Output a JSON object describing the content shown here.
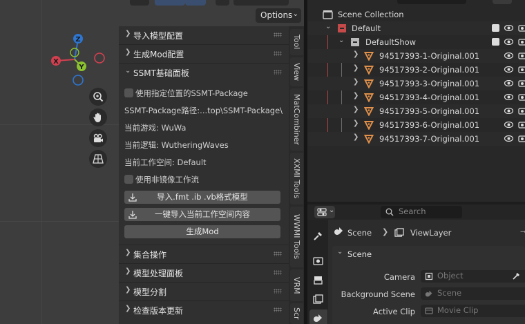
{
  "viewport": {
    "options_label": "Options",
    "gizmo": {
      "z": "Z",
      "x": "X",
      "y": "Y"
    }
  },
  "npanel": {
    "sections": [
      {
        "label": "导入模型配置",
        "expanded": false
      },
      {
        "label": "生成Mod配置",
        "expanded": false
      },
      {
        "label": "SSMT基础面板",
        "expanded": true
      }
    ],
    "ssmt": {
      "use_custom_package": "使用指定位置的SSMT-Package",
      "package_path": "SSMT-Package路径:...top\\SSMT-Package\\",
      "current_game": "当前游戏: WuWa",
      "current_logic": "当前逻辑: WutheringWaves",
      "current_workspace": "当前工作空间: Default",
      "use_non_mirror": "使用非镜像工作流",
      "import_btn": "导入.fmt .ib .vb格式模型",
      "import_workspace_btn": "一键导入当前工作空间内容",
      "generate_btn": "生成Mod"
    },
    "bottom_sections": [
      {
        "label": "集合操作"
      },
      {
        "label": "模型处理面板"
      },
      {
        "label": "模型分割"
      },
      {
        "label": "检查版本更新"
      }
    ]
  },
  "tabs": [
    "Tool",
    "View",
    "MatCombiner",
    "XXMI Tools",
    "WWMI Tools",
    "VRM",
    "Scr"
  ],
  "outliner": {
    "root": "Scene Collection",
    "collection": "Default",
    "subcollection": "DefaultShow",
    "objects": [
      "94517393-1-Original.001",
      "94517393-2-Original.001",
      "94517393-3-Original.001",
      "94517393-4-Original.001",
      "94517393-5-Original.001",
      "94517393-6-Original.001",
      "94517393-7-Original.001"
    ]
  },
  "properties": {
    "search_placeholder": "Search",
    "breadcrumb_scene": "Scene",
    "breadcrumb_viewlayer": "ViewLayer",
    "panel_title": "Scene",
    "fields": [
      {
        "label": "Camera",
        "placeholder": "Object"
      },
      {
        "label": "Background Scene",
        "placeholder": "Scene"
      },
      {
        "label": "Active Clip",
        "placeholder": "Movie Clip"
      }
    ]
  },
  "colors": {
    "axis_x": "#d2404f",
    "axis_y": "#8cc130",
    "axis_z": "#2e76d1",
    "object_orange": "#e0904a",
    "collection_red": "#c74a4a"
  }
}
